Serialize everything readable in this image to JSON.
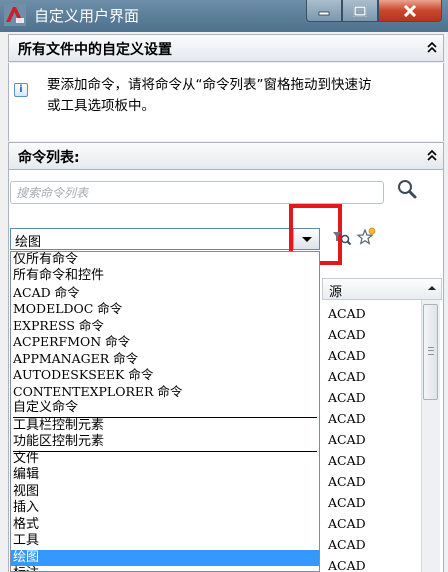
{
  "window": {
    "title": "自定义用户界面",
    "controls": [
      "minimize-icon",
      "maximize-icon",
      "close-icon"
    ]
  },
  "section_custom": {
    "title": "所有文件中的自定义设置",
    "info_text": "要添加命令，请将命令从“命令列表”窗格拖动到快速访\n或工具选项板中。"
  },
  "section_commands": {
    "title": "命令列表:",
    "search_placeholder": "搜索命令列表",
    "filter_value": "绘图",
    "list_header": "源",
    "list_rows": [
      "ACAD",
      "ACAD",
      "ACAD",
      "ACAD",
      "ACAD",
      "ACAD",
      "ACAD",
      "ACAD",
      "ACAD",
      "ACAD",
      "ACAD",
      "ACAD",
      "ACAD"
    ]
  },
  "dropdown": {
    "group1": [
      "仅所有命令",
      "所有命令和控件",
      "ACAD 命令",
      "MODELDOC 命令",
      "EXPRESS 命令",
      "ACPERFMON 命令",
      "APPMANAGER 命令",
      "AUTODESKSEEK 命令",
      "CONTENTEXPLORER 命令",
      "自定义命令"
    ],
    "group2": [
      "工具栏控制元素",
      "功能区控制元素"
    ],
    "group3": [
      "文件",
      "编辑",
      "视图",
      "插入",
      "格式",
      "工具",
      "绘图",
      "标注"
    ],
    "selected": "绘图"
  },
  "colors": {
    "accent": "#3399ff",
    "highlight_box": "#e3181b",
    "titlebar": "#5a7d98"
  }
}
